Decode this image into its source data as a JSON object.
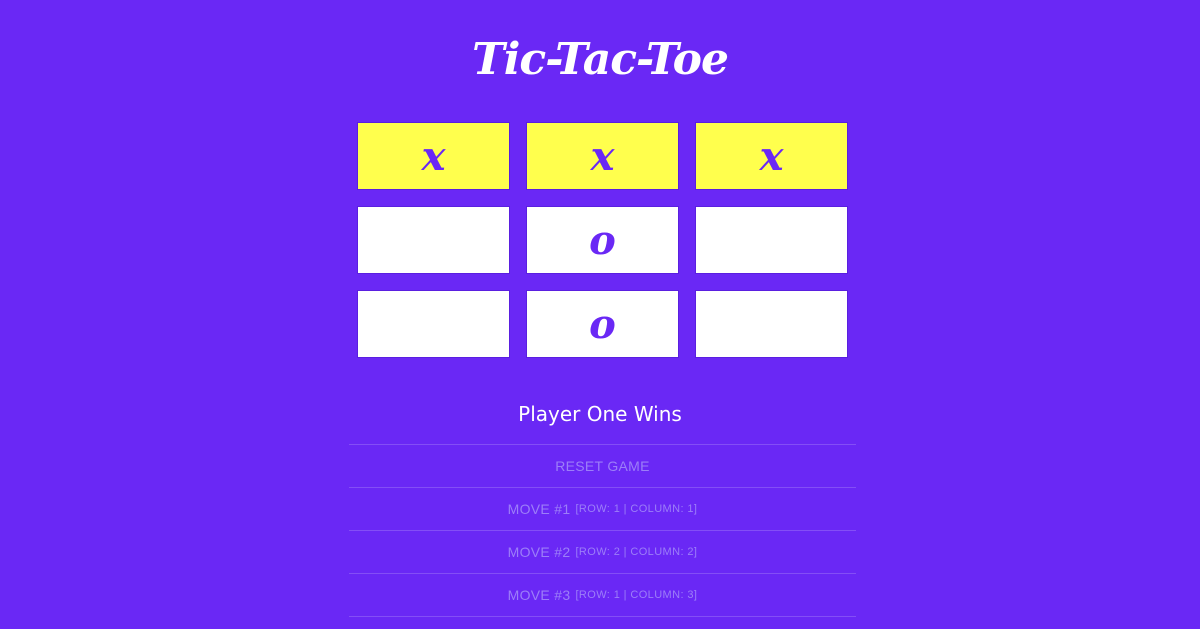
{
  "title": "Tic-Tac-Toe",
  "board": [
    [
      "x",
      "x",
      "x"
    ],
    [
      "",
      "o",
      ""
    ],
    [
      "",
      "o",
      ""
    ]
  ],
  "winning_row": 0,
  "status": "Player One Wins",
  "reset_label": "RESET GAME",
  "moves": [
    {
      "label": "MOVE #1",
      "detail": "[ROW: 1 | COLUMN: 1]"
    },
    {
      "label": "MOVE #2",
      "detail": "[ROW: 2 | COLUMN: 2]"
    },
    {
      "label": "MOVE #3",
      "detail": "[ROW: 1 | COLUMN: 3]"
    }
  ],
  "colors": {
    "background": "#6a28f5",
    "cell": "#ffffff",
    "win_cell": "#ffff4d",
    "mark": "#6a28f5"
  }
}
